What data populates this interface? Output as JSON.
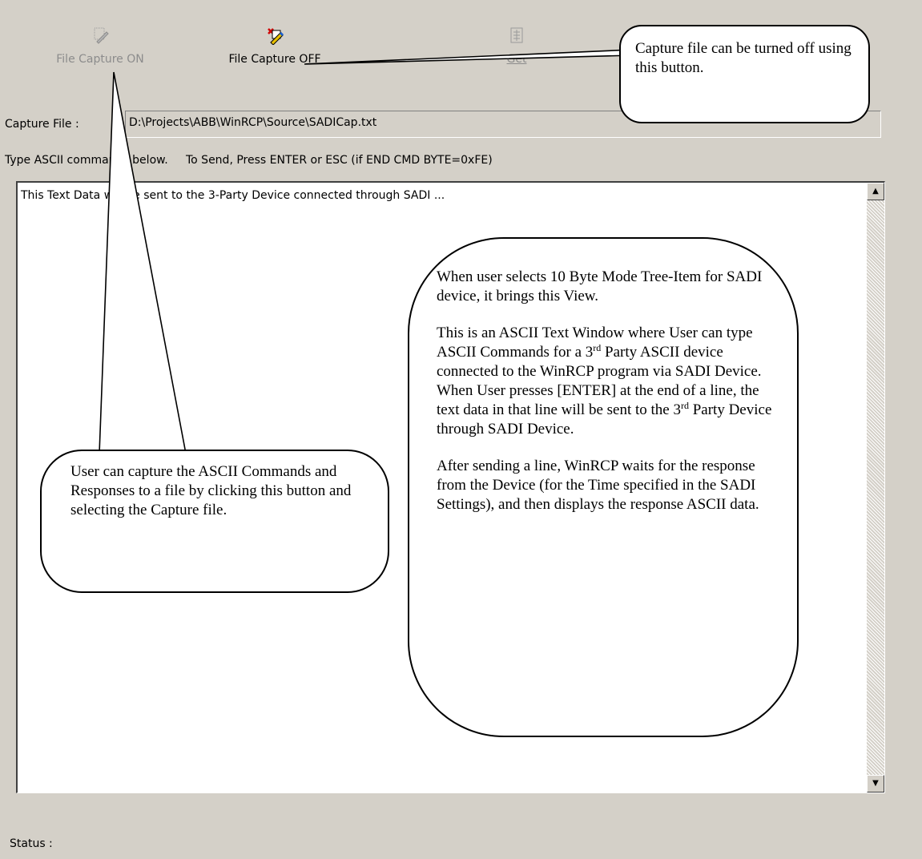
{
  "toolbar": {
    "capture_on_label": "File Capture ON",
    "capture_off_label": "File Capture OFF",
    "get_label": "Get"
  },
  "capture_file": {
    "label": "Capture File :",
    "value": "D:\\Projects\\ABB\\WinRCP\\Source\\SADICap.txt"
  },
  "instructions": "Type ASCII commands below.     To Send, Press ENTER or ESC (if END CMD BYTE=0xFE)",
  "text_area": {
    "content": "This Text Data will be sent to the 3-Party Device connected through SADI ..."
  },
  "status": {
    "label": "Status :"
  },
  "callouts": {
    "capture_off": "Capture file can be turned off using this button.",
    "capture_on": "User can capture the ASCII Commands and Responses to a file by clicking this button and selecting the Capture file.",
    "view_intro": "When user selects 10 Byte Mode Tree-Item for SADI device, it brings this  View.",
    "view_p2a": "This is an ASCII Text Window where User can type ASCII Commands for a 3",
    "view_p2_sup": "rd",
    "view_p2b": " Party ASCII device connected to the WinRCP program via SADI Device. When User presses [ENTER] at the end of a line, the text data in that line will be sent to the 3",
    "view_p2_sup2": "rd",
    "view_p2c": " Party Device through SADI Device.",
    "view_p3": "After sending a line, WinRCP waits for the response from the Device (for the Time specified in the SADI Settings), and then displays the response ASCII data."
  },
  "icons": {
    "capture_on": "pencil-file-icon",
    "capture_off": "pencil-cross-icon",
    "get": "get-icon"
  }
}
